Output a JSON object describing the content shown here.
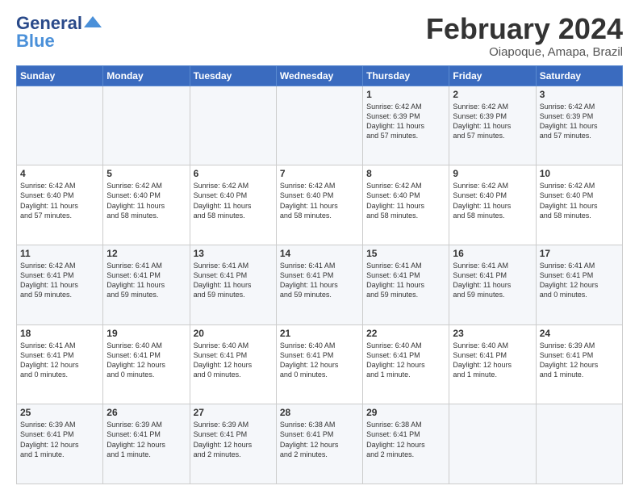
{
  "header": {
    "logo_general": "General",
    "logo_blue": "Blue",
    "month_title": "February 2024",
    "location": "Oiapoque, Amapa, Brazil"
  },
  "days_of_week": [
    "Sunday",
    "Monday",
    "Tuesday",
    "Wednesday",
    "Thursday",
    "Friday",
    "Saturday"
  ],
  "weeks": [
    [
      {
        "day": "",
        "info": ""
      },
      {
        "day": "",
        "info": ""
      },
      {
        "day": "",
        "info": ""
      },
      {
        "day": "",
        "info": ""
      },
      {
        "day": "1",
        "info": "Sunrise: 6:42 AM\nSunset: 6:39 PM\nDaylight: 11 hours\nand 57 minutes."
      },
      {
        "day": "2",
        "info": "Sunrise: 6:42 AM\nSunset: 6:39 PM\nDaylight: 11 hours\nand 57 minutes."
      },
      {
        "day": "3",
        "info": "Sunrise: 6:42 AM\nSunset: 6:39 PM\nDaylight: 11 hours\nand 57 minutes."
      }
    ],
    [
      {
        "day": "4",
        "info": "Sunrise: 6:42 AM\nSunset: 6:40 PM\nDaylight: 11 hours\nand 57 minutes."
      },
      {
        "day": "5",
        "info": "Sunrise: 6:42 AM\nSunset: 6:40 PM\nDaylight: 11 hours\nand 58 minutes."
      },
      {
        "day": "6",
        "info": "Sunrise: 6:42 AM\nSunset: 6:40 PM\nDaylight: 11 hours\nand 58 minutes."
      },
      {
        "day": "7",
        "info": "Sunrise: 6:42 AM\nSunset: 6:40 PM\nDaylight: 11 hours\nand 58 minutes."
      },
      {
        "day": "8",
        "info": "Sunrise: 6:42 AM\nSunset: 6:40 PM\nDaylight: 11 hours\nand 58 minutes."
      },
      {
        "day": "9",
        "info": "Sunrise: 6:42 AM\nSunset: 6:40 PM\nDaylight: 11 hours\nand 58 minutes."
      },
      {
        "day": "10",
        "info": "Sunrise: 6:42 AM\nSunset: 6:40 PM\nDaylight: 11 hours\nand 58 minutes."
      }
    ],
    [
      {
        "day": "11",
        "info": "Sunrise: 6:42 AM\nSunset: 6:41 PM\nDaylight: 11 hours\nand 59 minutes."
      },
      {
        "day": "12",
        "info": "Sunrise: 6:41 AM\nSunset: 6:41 PM\nDaylight: 11 hours\nand 59 minutes."
      },
      {
        "day": "13",
        "info": "Sunrise: 6:41 AM\nSunset: 6:41 PM\nDaylight: 11 hours\nand 59 minutes."
      },
      {
        "day": "14",
        "info": "Sunrise: 6:41 AM\nSunset: 6:41 PM\nDaylight: 11 hours\nand 59 minutes."
      },
      {
        "day": "15",
        "info": "Sunrise: 6:41 AM\nSunset: 6:41 PM\nDaylight: 11 hours\nand 59 minutes."
      },
      {
        "day": "16",
        "info": "Sunrise: 6:41 AM\nSunset: 6:41 PM\nDaylight: 11 hours\nand 59 minutes."
      },
      {
        "day": "17",
        "info": "Sunrise: 6:41 AM\nSunset: 6:41 PM\nDaylight: 12 hours\nand 0 minutes."
      }
    ],
    [
      {
        "day": "18",
        "info": "Sunrise: 6:41 AM\nSunset: 6:41 PM\nDaylight: 12 hours\nand 0 minutes."
      },
      {
        "day": "19",
        "info": "Sunrise: 6:40 AM\nSunset: 6:41 PM\nDaylight: 12 hours\nand 0 minutes."
      },
      {
        "day": "20",
        "info": "Sunrise: 6:40 AM\nSunset: 6:41 PM\nDaylight: 12 hours\nand 0 minutes."
      },
      {
        "day": "21",
        "info": "Sunrise: 6:40 AM\nSunset: 6:41 PM\nDaylight: 12 hours\nand 0 minutes."
      },
      {
        "day": "22",
        "info": "Sunrise: 6:40 AM\nSunset: 6:41 PM\nDaylight: 12 hours\nand 1 minute."
      },
      {
        "day": "23",
        "info": "Sunrise: 6:40 AM\nSunset: 6:41 PM\nDaylight: 12 hours\nand 1 minute."
      },
      {
        "day": "24",
        "info": "Sunrise: 6:39 AM\nSunset: 6:41 PM\nDaylight: 12 hours\nand 1 minute."
      }
    ],
    [
      {
        "day": "25",
        "info": "Sunrise: 6:39 AM\nSunset: 6:41 PM\nDaylight: 12 hours\nand 1 minute."
      },
      {
        "day": "26",
        "info": "Sunrise: 6:39 AM\nSunset: 6:41 PM\nDaylight: 12 hours\nand 1 minute."
      },
      {
        "day": "27",
        "info": "Sunrise: 6:39 AM\nSunset: 6:41 PM\nDaylight: 12 hours\nand 2 minutes."
      },
      {
        "day": "28",
        "info": "Sunrise: 6:38 AM\nSunset: 6:41 PM\nDaylight: 12 hours\nand 2 minutes."
      },
      {
        "day": "29",
        "info": "Sunrise: 6:38 AM\nSunset: 6:41 PM\nDaylight: 12 hours\nand 2 minutes."
      },
      {
        "day": "",
        "info": ""
      },
      {
        "day": "",
        "info": ""
      }
    ]
  ]
}
